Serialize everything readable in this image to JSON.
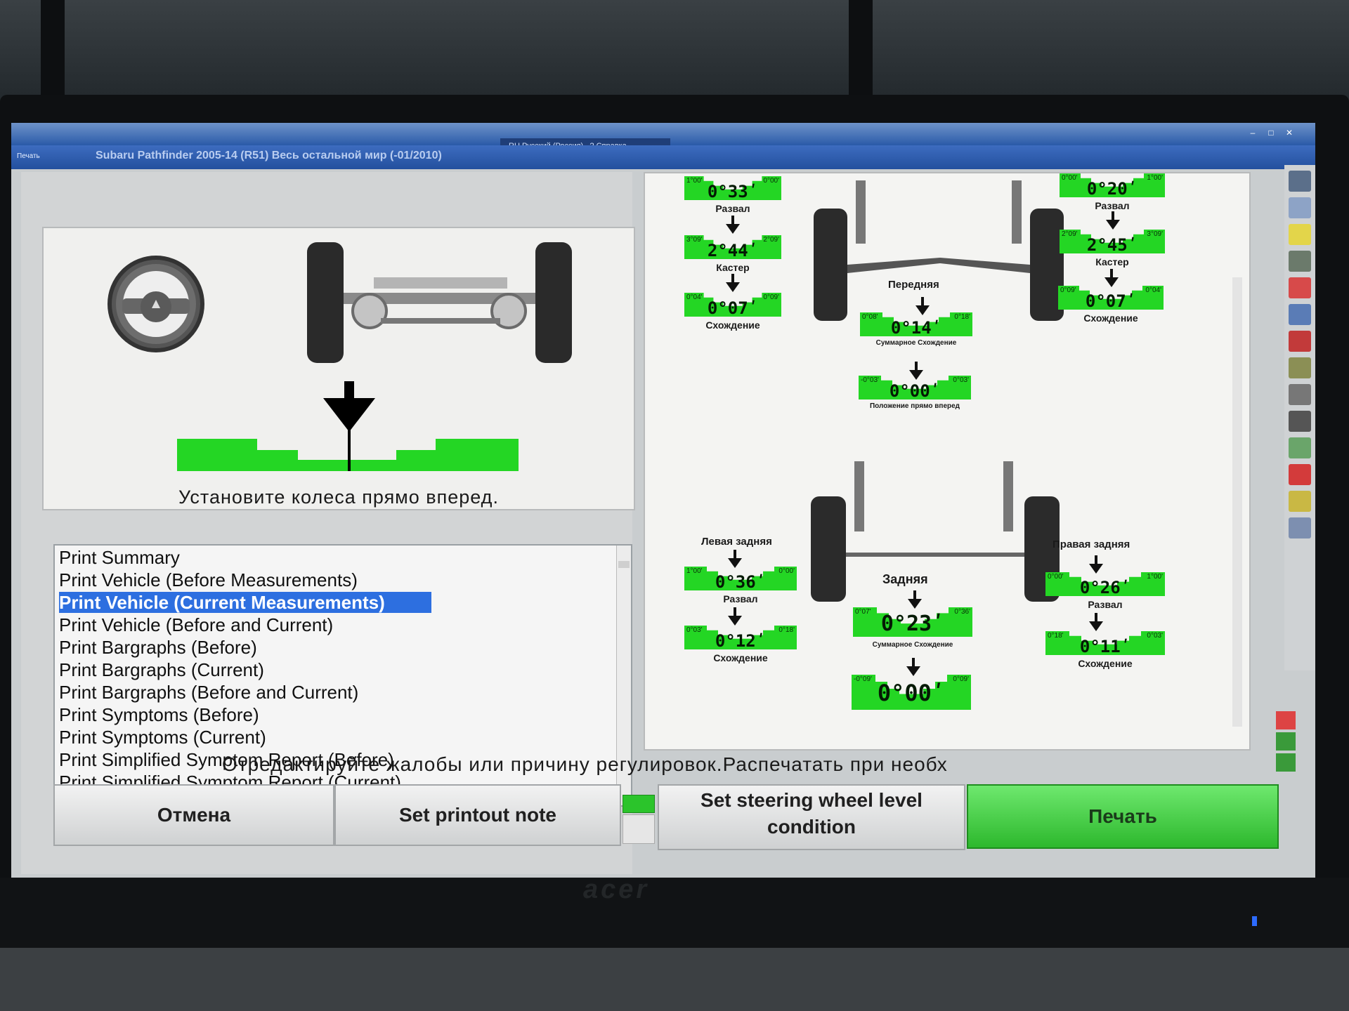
{
  "app": {
    "title": "",
    "language": "RU Русский (Россия)",
    "help": "Справка",
    "menu_label": "Печать",
    "vehicle": "Subaru  Pathfinder  2005-14 (R51)  Весь остальной мир (-01/2010)"
  },
  "instruction": "Установите колеса прямо вперед.",
  "print_options": [
    {
      "label": "Print Summary",
      "selected": false
    },
    {
      "label": "Print Vehicle (Before Measurements)",
      "selected": false
    },
    {
      "label": "Print Vehicle (Current Measurements)",
      "selected": true
    },
    {
      "label": "Print Vehicle (Before and Current)",
      "selected": false
    },
    {
      "label": "Print Bargraphs (Before)",
      "selected": false
    },
    {
      "label": "Print Bargraphs (Current)",
      "selected": false
    },
    {
      "label": "Print Bargraphs (Before and Current)",
      "selected": false
    },
    {
      "label": "Print Symptoms (Before)",
      "selected": false
    },
    {
      "label": "Print Symptoms (Current)",
      "selected": false
    },
    {
      "label": "Print Simplified Symptom Report (Before)",
      "selected": false
    },
    {
      "label": "Print Simplified Symptom Report (Current)",
      "selected": false
    }
  ],
  "status_line": "Отредактируйте жалобы или причину регулировок.Распечатать при необх",
  "buttons": {
    "cancel": "Отмена",
    "printout_note": "Set printout note",
    "steering_line1": "Set steering wheel level",
    "steering_line2": "condition",
    "print": "Печать"
  },
  "front": {
    "axle_label": "Передняя",
    "left_camber": {
      "value": "0°33ʹ",
      "min": "1°00'",
      "max": "0°00'",
      "label": "Развал"
    },
    "left_caster": {
      "value": "2°44ʹ",
      "min": "3°09'",
      "max": "2°09'",
      "label": "Кастер"
    },
    "left_toe": {
      "value": "0°07ʹ",
      "min": "0°04'",
      "max": "0°09'",
      "label": "Схождение"
    },
    "right_camber": {
      "value": "0°20ʹ",
      "min": "0°00'",
      "max": "1°00'",
      "label": "Развал"
    },
    "right_caster": {
      "value": "2°45ʹ",
      "min": "2°09'",
      "max": "3°09'",
      "label": "Кастер"
    },
    "right_toe": {
      "value": "0°07ʹ",
      "min": "0°09'",
      "max": "0°04'",
      "label": "Схождение"
    },
    "total_toe": {
      "value": "0°14ʹ",
      "min": "0°08'",
      "max": "0°18'",
      "label": "Суммарное Схождение"
    },
    "straight_ahead": {
      "value": "0°00ʹ",
      "min": "-0°03'",
      "max": "0°03'",
      "label": "Положение прямо вперед"
    }
  },
  "rear": {
    "axle_label": "Задняя",
    "left_label": "Левая задняя",
    "right_label": "Правая задняя",
    "left_camber": {
      "value": "0°36ʹ",
      "min": "1°00'",
      "max": "0°00'",
      "label": "Развал"
    },
    "left_toe": {
      "value": "0°12ʹ",
      "min": "0°03'",
      "max": "0°18'",
      "label": "Схождение"
    },
    "right_camber": {
      "value": "0°26ʹ",
      "min": "0°00'",
      "max": "1°00'",
      "label": "Развал"
    },
    "right_toe": {
      "value": "0°11ʹ",
      "min": "0°18'",
      "max": "0°03'",
      "label": "Схождение"
    },
    "total_toe": {
      "value": "0°23ʹ",
      "min": "0°07'",
      "max": "0°36'",
      "label": "Суммарное Схождение"
    },
    "thrust": {
      "value": "0°00ʹ",
      "min": "-0°09'",
      "max": "0°09'"
    }
  },
  "colors": {
    "in_spec_green": "#24d624",
    "selection_blue": "#2d6fe0",
    "print_button": "#3bc83b"
  }
}
